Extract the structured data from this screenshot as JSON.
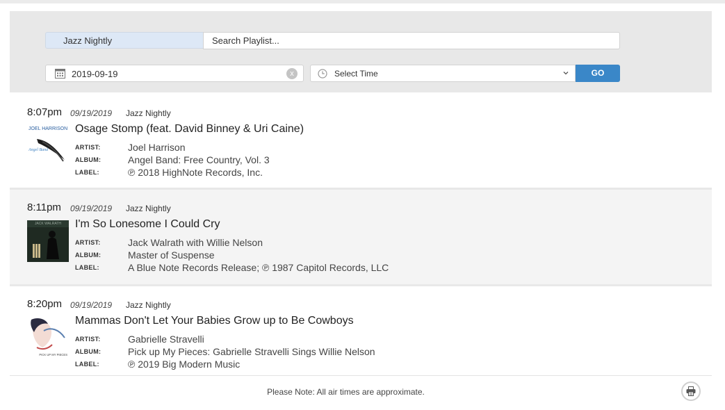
{
  "filters": {
    "station": "Jazz Nightly",
    "search_placeholder": "Search Playlist...",
    "date_value": "2019-09-19",
    "clear_label": "x",
    "time_value": "Select Time",
    "go_label": "GO"
  },
  "labels": {
    "artist": "ARTIST:",
    "album": "ALBUM:",
    "label": "LABEL:"
  },
  "entries": [
    {
      "time": "8:07pm",
      "date": "09/19/2019",
      "station": "Jazz Nightly",
      "title": "Osage Stomp (feat. David Binney & Uri Caine)",
      "artist": "Joel Harrison",
      "album": "Angel Band: Free Country, Vol. 3",
      "label": "℗ 2018 HighNote Records, Inc.",
      "art_text": "JOEL HARRISON",
      "art_subtext": "Angel Band"
    },
    {
      "time": "8:11pm",
      "date": "09/19/2019",
      "station": "Jazz Nightly",
      "title": "I'm So Lonesome I Could Cry",
      "artist": "Jack Walrath with Willie Nelson",
      "album": "Master of Suspense",
      "label": "A Blue Note Records Release; ℗ 1987 Capitol Records, LLC",
      "art_text": "JACK WALRATH"
    },
    {
      "time": "8:20pm",
      "date": "09/19/2019",
      "station": "Jazz Nightly",
      "title": "Mammas Don't Let Your Babies Grow up to Be Cowboys",
      "artist": "Gabrielle Stravelli",
      "album": "Pick up My Pieces: Gabrielle Stravelli Sings Willie Nelson",
      "label": "℗ 2019 Big Modern Music",
      "art_text": "PICK UP MY PIECES"
    }
  ],
  "footer": {
    "note": "Please Note: All air times are approximate."
  },
  "colors": {
    "accent": "#3a87c8",
    "panel": "#e8e8e8",
    "station_tab": "#dde8f6"
  }
}
